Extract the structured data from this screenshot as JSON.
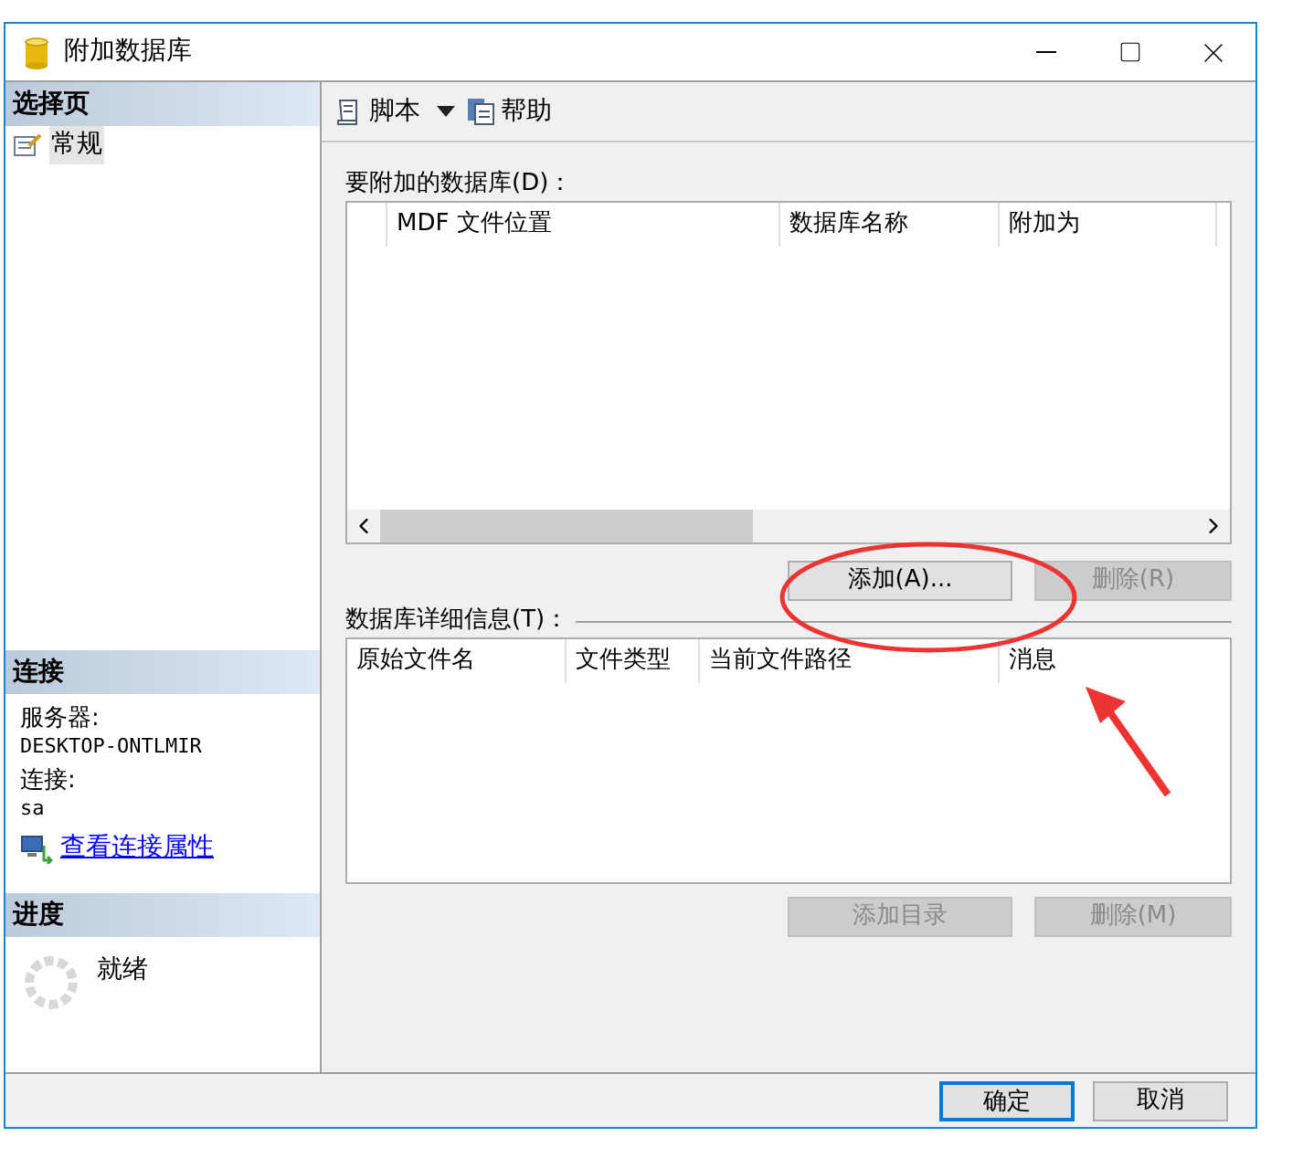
{
  "window": {
    "title": "附加数据库"
  },
  "sidebar": {
    "select_page": {
      "heading": "选择页",
      "items": [
        {
          "label": "常规",
          "selected": true
        }
      ]
    },
    "connection": {
      "heading": "连接",
      "server_label": "服务器:",
      "server": "DESKTOP-ONTLMIR",
      "connection_label": "连接:",
      "user": "sa",
      "link": "查看连接属性"
    },
    "progress": {
      "heading": "进度",
      "status": "就绪"
    }
  },
  "toolbar": {
    "items": [
      {
        "label": "脚本",
        "kind": "dropdown"
      },
      {
        "label": "帮助",
        "kind": "button"
      }
    ]
  },
  "databases": {
    "label": "要附加的数据库(D)：",
    "columns": [
      "MDF 文件位置",
      "数据库名称",
      "附加为"
    ],
    "buttons": [
      {
        "label": "添加(A)...",
        "disabled": false
      },
      {
        "label": "删除(R)",
        "disabled": true
      }
    ]
  },
  "details": {
    "label": "数据库详细信息(T)：",
    "columns": [
      "原始文件名",
      "文件类型",
      "当前文件路径",
      "消息"
    ],
    "buttons": [
      {
        "label": "添加目录",
        "disabled": true
      },
      {
        "label": "删除(M)",
        "disabled": true
      }
    ]
  },
  "footer": {
    "buttons": [
      {
        "label": "确定",
        "default": true
      },
      {
        "label": "取消",
        "default": false
      }
    ]
  }
}
